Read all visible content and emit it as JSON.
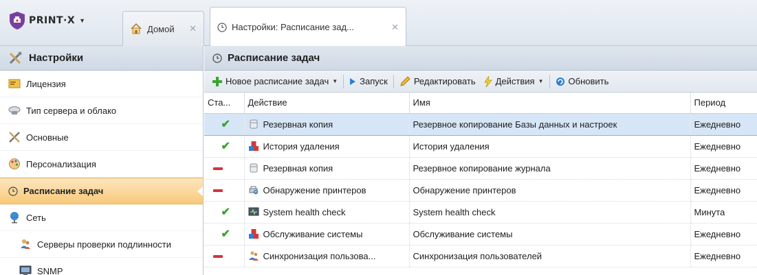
{
  "app": {
    "logo_text": "PRINT·X",
    "brand_colors": {
      "shield": "#7a3f9e",
      "accent": "#c23a2e"
    }
  },
  "tabs": [
    {
      "label": "Домой",
      "icon": "home-icon",
      "active": false
    },
    {
      "label": "Настройки: Расписание зад...",
      "icon": "clock-icon",
      "active": true
    }
  ],
  "sidebar": {
    "title": "Настройки",
    "items": [
      {
        "label": "Лицензия",
        "icon": "license-icon"
      },
      {
        "label": "Тип сервера и облако",
        "icon": "cloud-server-icon"
      },
      {
        "label": "Основные",
        "icon": "tools-icon"
      },
      {
        "label": "Персонализация",
        "icon": "palette-icon"
      },
      {
        "label": "Расписание задач",
        "icon": "clock-icon",
        "selected": true
      },
      {
        "label": "Сеть",
        "icon": "globe-icon"
      },
      {
        "label": "Серверы проверки подлинности",
        "icon": "users-icon"
      },
      {
        "label": "SNMP",
        "icon": "monitor-icon"
      }
    ]
  },
  "main": {
    "title": "Расписание задач",
    "toolbar": {
      "new_label": "Новое расписание задач",
      "run_label": "Запуск",
      "edit_label": "Редактировать",
      "actions_label": "Действия",
      "refresh_label": "Обновить"
    },
    "columns": [
      "Ста...",
      "Действие",
      "Имя",
      "Период"
    ],
    "rows": [
      {
        "status": "enabled",
        "action": "Резервная копия",
        "action_icon": "database-icon",
        "name": "Резервное копирование Базы данных и настроек",
        "period": "Ежедневно",
        "selected": true
      },
      {
        "status": "enabled",
        "action": "История удаления",
        "action_icon": "blocks-icon",
        "name": "История удаления",
        "period": "Ежедневно"
      },
      {
        "status": "disabled",
        "action": "Резервная копия",
        "action_icon": "database-icon",
        "name": "Резервное копирование журнала",
        "period": "Ежедневно"
      },
      {
        "status": "disabled",
        "action": "Обнаружение принтеров",
        "action_icon": "printer-search-icon",
        "name": "Обнаружение принтеров",
        "period": "Ежедневно"
      },
      {
        "status": "enabled",
        "action": "System health check",
        "action_icon": "health-monitor-icon",
        "name": "System health check",
        "period": "Минута"
      },
      {
        "status": "enabled",
        "action": "Обслуживание системы",
        "action_icon": "blocks-icon",
        "name": "Обслуживание системы",
        "period": "Ежедневно"
      },
      {
        "status": "disabled",
        "action": "Синхронизация пользова...",
        "action_icon": "users-icon",
        "name": "Синхронизация пользователей",
        "period": "Ежедневно"
      }
    ]
  }
}
